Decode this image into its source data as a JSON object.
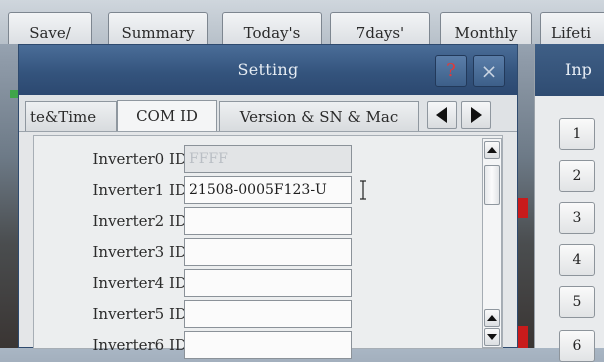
{
  "top_tabs": [
    "Save/",
    "Summary",
    "Today's",
    "7days'",
    "Monthly",
    "Lifeti"
  ],
  "right_panel": {
    "header": "Inp",
    "buttons": [
      "1",
      "2",
      "3",
      "4",
      "5",
      "6"
    ]
  },
  "dialog": {
    "title": "Setting",
    "help_label": "?",
    "close_label": "×",
    "tabs": [
      "te&Time",
      "COM ID",
      "Version & SN & Mac"
    ],
    "active_tab": "COM ID",
    "rows": [
      {
        "label": "Inverter0 ID:",
        "value": "FFFF"
      },
      {
        "label": "Inverter1 ID:",
        "value": "21508-0005F123-U"
      },
      {
        "label": "Inverter2 ID:",
        "value": ""
      },
      {
        "label": "Inverter3 ID:",
        "value": ""
      },
      {
        "label": "Inverter4 ID:",
        "value": ""
      },
      {
        "label": "Inverter5 ID:",
        "value": ""
      },
      {
        "label": "Inverter6 ID:",
        "value": ""
      }
    ]
  },
  "colors": {
    "title_bar": "#34547d",
    "accent_red": "#c81b1b",
    "close_icon": "#e03a3a"
  },
  "icons": {
    "tab_prev": "triangle-left-icon",
    "tab_next": "triangle-right-icon",
    "scroll_up": "scroll-up-icon",
    "scroll_down": "scroll-down-icon",
    "text_cursor": "i-beam-cursor-icon"
  }
}
